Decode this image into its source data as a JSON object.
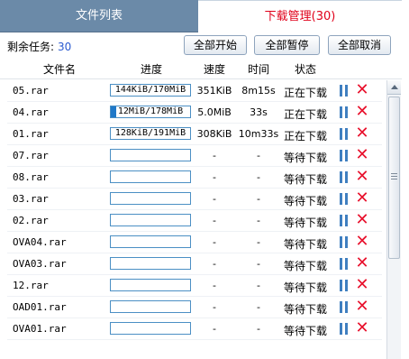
{
  "tabs": {
    "files_label": "文件列表",
    "downloads_label": "下载管理(30)"
  },
  "toolbar": {
    "remaining_label": "剩余任务:",
    "remaining_count": "30",
    "start_all_label": "全部开始",
    "pause_all_label": "全部暂停",
    "cancel_all_label": "全部取消"
  },
  "columns": {
    "name": "文件名",
    "progress": "进度",
    "speed": "速度",
    "time": "时间",
    "status": "状态"
  },
  "icons": {
    "pause": "pause-icon",
    "cancel": "close-icon"
  },
  "colors": {
    "accent_red": "#e0001a",
    "progress_blue": "#1f78c8"
  },
  "rows": [
    {
      "name": "05.rar",
      "progress_text": "144KiB/170MiB",
      "progress": 0.0,
      "speed": "351KiB",
      "time": "8m15s",
      "status": "正在下载"
    },
    {
      "name": "04.rar",
      "progress_text": "12MiB/178MiB",
      "progress": 0.07,
      "speed": "5.0MiB",
      "time": "33s",
      "status": "正在下载"
    },
    {
      "name": "01.rar",
      "progress_text": "128KiB/191MiB",
      "progress": 0.0,
      "speed": "308KiB",
      "time": "10m33s",
      "status": "正在下载"
    },
    {
      "name": "07.rar",
      "progress_text": "",
      "progress": 0,
      "speed": "-",
      "time": "-",
      "status": "等待下载"
    },
    {
      "name": "08.rar",
      "progress_text": "",
      "progress": 0,
      "speed": "-",
      "time": "-",
      "status": "等待下载"
    },
    {
      "name": "03.rar",
      "progress_text": "",
      "progress": 0,
      "speed": "-",
      "time": "-",
      "status": "等待下载"
    },
    {
      "name": "02.rar",
      "progress_text": "",
      "progress": 0,
      "speed": "-",
      "time": "-",
      "status": "等待下载"
    },
    {
      "name": "OVA04.rar",
      "progress_text": "",
      "progress": 0,
      "speed": "-",
      "time": "-",
      "status": "等待下载"
    },
    {
      "name": "OVA03.rar",
      "progress_text": "",
      "progress": 0,
      "speed": "-",
      "time": "-",
      "status": "等待下载"
    },
    {
      "name": "12.rar",
      "progress_text": "",
      "progress": 0,
      "speed": "-",
      "time": "-",
      "status": "等待下载"
    },
    {
      "name": "OAD01.rar",
      "progress_text": "",
      "progress": 0,
      "speed": "-",
      "time": "-",
      "status": "等待下载"
    },
    {
      "name": "OVA01.rar",
      "progress_text": "",
      "progress": 0,
      "speed": "-",
      "time": "-",
      "status": "等待下载"
    }
  ]
}
